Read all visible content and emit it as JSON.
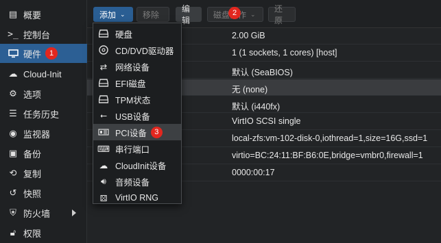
{
  "sidebar": {
    "items": [
      {
        "icon": "doc-icon",
        "label": "概要"
      },
      {
        "icon": "console-icon",
        "label": "控制台"
      },
      {
        "icon": "monitor-icon",
        "label": "硬件",
        "badge": "1"
      },
      {
        "icon": "cloud-icon",
        "label": "Cloud-Init"
      },
      {
        "icon": "gear-icon",
        "label": "选项"
      },
      {
        "icon": "list-icon",
        "label": "任务历史"
      },
      {
        "icon": "eye-icon",
        "label": "监视器"
      },
      {
        "icon": "save-icon",
        "label": "备份"
      },
      {
        "icon": "refresh-icon",
        "label": "复制"
      },
      {
        "icon": "history-icon",
        "label": "快照"
      },
      {
        "icon": "shield-icon",
        "label": "防火墙"
      },
      {
        "icon": "unlock-icon",
        "label": "权限"
      }
    ]
  },
  "toolbar": {
    "add_label": "添加",
    "add_badge": "2",
    "remove_label": "移除",
    "edit_label": "编辑",
    "disk_ops_label": "磁盘操作",
    "revert_label": "还原"
  },
  "table": {
    "rows": [
      {
        "value": "2.00 GiB"
      },
      {
        "value": "1 (1 sockets, 1 cores) [host]"
      },
      {
        "value": "默认 (SeaBIOS)"
      },
      {
        "value": "无 (none)"
      },
      {
        "value": "默认 (i440fx)"
      },
      {
        "value": "VirtIO SCSI single"
      },
      {
        "value": "local-zfs:vm-102-disk-0,iothread=1,size=16G,ssd=1"
      },
      {
        "value": "virtio=BC:24:11:BF:B6:0E,bridge=vmbr0,firewall=1"
      },
      {
        "value": "0000:00:17"
      }
    ]
  },
  "add_menu": {
    "items": [
      {
        "icon": "hdd-icon",
        "label": "硬盘"
      },
      {
        "icon": "cdrom-icon",
        "label": "CD/DVD驱动器"
      },
      {
        "icon": "network-icon",
        "label": "网络设备"
      },
      {
        "icon": "hdd-icon",
        "label": "EFI磁盘"
      },
      {
        "icon": "hdd-icon",
        "label": "TPM状态"
      },
      {
        "icon": "usb-icon",
        "label": "USB设备"
      },
      {
        "icon": "pci-icon",
        "label": "PCI设备",
        "badge": "3"
      },
      {
        "icon": "keyboard-icon",
        "label": "串行端口"
      },
      {
        "icon": "cloud-icon",
        "label": "CloudInit设备"
      },
      {
        "icon": "speaker-icon",
        "label": "音频设备"
      },
      {
        "icon": "dice-icon",
        "label": "VirtIO RNG"
      }
    ]
  }
}
